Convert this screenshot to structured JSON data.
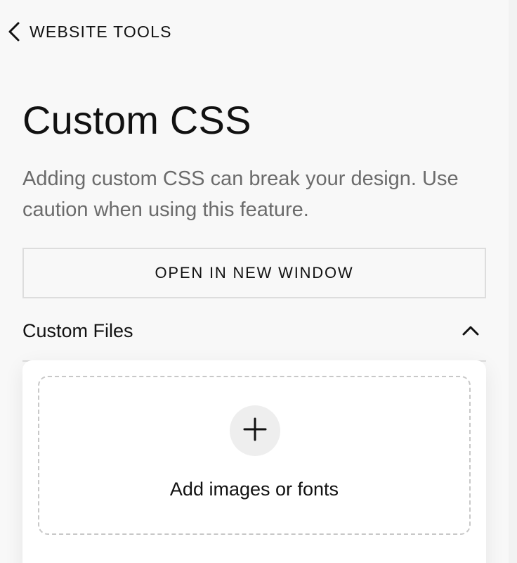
{
  "nav": {
    "back_label": "WEBSITE TOOLS"
  },
  "page": {
    "title": "Custom CSS",
    "description": "Adding custom CSS can break your design. Use caution when using this feature."
  },
  "actions": {
    "open_window_label": "OPEN IN NEW WINDOW"
  },
  "custom_files": {
    "section_label": "Custom Files",
    "expanded": true,
    "dropzone_label": "Add images or fonts"
  },
  "icons": {
    "back": "chevron-left-icon",
    "collapse": "chevron-up-icon",
    "add": "plus-icon"
  },
  "colors": {
    "background": "#f8f8f8",
    "text_primary": "#111111",
    "text_secondary": "#6b6b6b",
    "border": "#dddddd",
    "card": "#ffffff",
    "plus_circle": "#eeeeee"
  }
}
